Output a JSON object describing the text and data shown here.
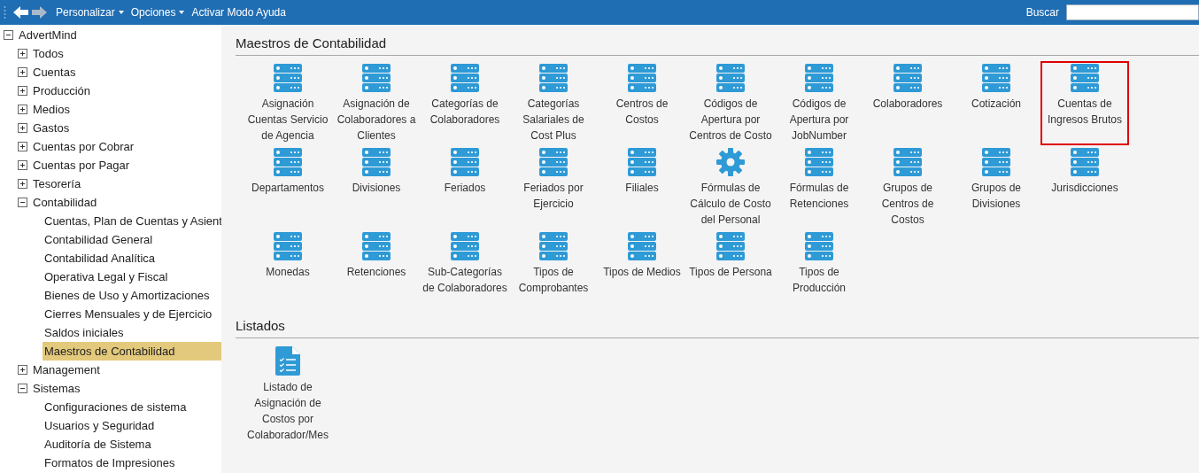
{
  "toolbar": {
    "back_disabled": false,
    "forward_disabled": true,
    "menus": [
      {
        "label": "Personalizar",
        "dropdown": true
      },
      {
        "label": "Opciones",
        "dropdown": true
      },
      {
        "label": "Activar Modo Ayuda",
        "dropdown": false
      }
    ],
    "search": {
      "label": "Buscar"
    }
  },
  "sidebar": {
    "items": [
      {
        "label": "AdvertMind",
        "expanded": true,
        "selected": false,
        "children": [
          {
            "label": "Todos",
            "expanded": false,
            "selected": false
          },
          {
            "label": "Cuentas",
            "expanded": false,
            "selected": false
          },
          {
            "label": "Producción",
            "expanded": false,
            "selected": false
          },
          {
            "label": "Medios",
            "expanded": false,
            "selected": false
          },
          {
            "label": "Gastos",
            "expanded": false,
            "selected": false
          },
          {
            "label": "Cuentas por Cobrar",
            "expanded": false,
            "selected": false
          },
          {
            "label": "Cuentas por Pagar",
            "expanded": false,
            "selected": false
          },
          {
            "label": "Tesorería",
            "expanded": false,
            "selected": false
          },
          {
            "label": "Contabilidad",
            "expanded": true,
            "selected": false,
            "children": [
              {
                "label": "Cuentas, Plan de Cuentas y Asient",
                "selected": false
              },
              {
                "label": "Contabilidad General",
                "selected": false
              },
              {
                "label": "Contabilidad Analítica",
                "selected": false
              },
              {
                "label": "Operativa Legal y Fiscal",
                "selected": false
              },
              {
                "label": "Bienes de Uso y Amortizaciones",
                "selected": false
              },
              {
                "label": "Cierres Mensuales y de Ejercicio",
                "selected": false
              },
              {
                "label": "Saldos iniciales",
                "selected": false
              },
              {
                "label": "Maestros de Contabilidad",
                "selected": true
              }
            ]
          },
          {
            "label": "Management",
            "expanded": false,
            "selected": false
          },
          {
            "label": "Sistemas",
            "expanded": true,
            "selected": false,
            "children": [
              {
                "label": "Configuraciones de sistema",
                "selected": false
              },
              {
                "label": "Usuarios y Seguridad",
                "selected": false
              },
              {
                "label": "Auditoría de Sistema",
                "selected": false
              },
              {
                "label": "Formatos de Impresiones",
                "selected": false
              }
            ]
          }
        ]
      }
    ]
  },
  "sections": [
    {
      "title": "Maestros de Contabilidad",
      "tiles": [
        {
          "label": "Asignación Cuentas Servicio de Agencia",
          "kind": "server",
          "selected": false
        },
        {
          "label": "Asignación de Colaboradores a Clientes",
          "kind": "server",
          "selected": false
        },
        {
          "label": "Categorías de Colaboradores",
          "kind": "server",
          "selected": false
        },
        {
          "label": "Categorías Salariales de Cost Plus",
          "kind": "server",
          "selected": false
        },
        {
          "label": "Centros de Costos",
          "kind": "server",
          "selected": false
        },
        {
          "label": "Códigos de Apertura por Centros de Costo",
          "kind": "server",
          "selected": false
        },
        {
          "label": "Códigos de Apertura por JobNumber",
          "kind": "server",
          "selected": false
        },
        {
          "label": "Colaboradores",
          "kind": "server",
          "selected": false
        },
        {
          "label": "Cotización",
          "kind": "server",
          "selected": false
        },
        {
          "label": "Cuentas de Ingresos Brutos",
          "kind": "server",
          "selected": true
        },
        {
          "label": "Departamentos",
          "kind": "server",
          "selected": false
        },
        {
          "label": "Divisiones",
          "kind": "server",
          "selected": false
        },
        {
          "label": "Feriados",
          "kind": "server",
          "selected": false
        },
        {
          "label": "Feriados por Ejercicio",
          "kind": "server",
          "selected": false
        },
        {
          "label": "Filiales",
          "kind": "server",
          "selected": false
        },
        {
          "label": "Fórmulas de Cálculo de Costo del Personal",
          "kind": "gear",
          "selected": false
        },
        {
          "label": "Fórmulas de Retenciones",
          "kind": "server",
          "selected": false
        },
        {
          "label": "Grupos de Centros de Costos",
          "kind": "server",
          "selected": false
        },
        {
          "label": "Grupos de Divisiones",
          "kind": "server",
          "selected": false
        },
        {
          "label": "Jurisdicciones",
          "kind": "server",
          "selected": false
        },
        {
          "label": "Monedas",
          "kind": "server",
          "selected": false
        },
        {
          "label": "Retenciones",
          "kind": "server",
          "selected": false
        },
        {
          "label": "Sub-Categorías de Colaboradores",
          "kind": "server",
          "selected": false
        },
        {
          "label": "Tipos de Comprobantes",
          "kind": "server",
          "selected": false
        },
        {
          "label": "Tipos de Medios",
          "kind": "server",
          "selected": false
        },
        {
          "label": "Tipos de Persona",
          "kind": "server",
          "selected": false
        },
        {
          "label": "Tipos de Producción",
          "kind": "server",
          "selected": false
        }
      ]
    },
    {
      "title": "Listados",
      "tiles": [
        {
          "label": "Listado de Asignación de Costos por Colaborador/Mes",
          "kind": "report",
          "selected": false
        }
      ]
    }
  ]
}
